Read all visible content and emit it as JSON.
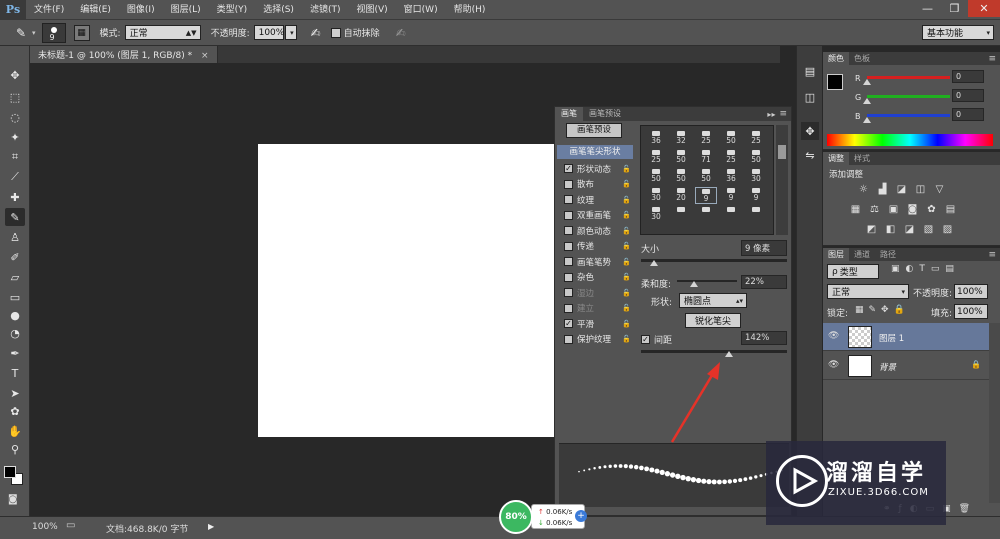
{
  "app": {
    "logo": "Ps"
  },
  "menu": [
    "文件(F)",
    "编辑(E)",
    "图像(I)",
    "图层(L)",
    "类型(Y)",
    "选择(S)",
    "滤镜(T)",
    "视图(V)",
    "窗口(W)",
    "帮助(H)"
  ],
  "window_buttons": {
    "minimize": "—",
    "restore": "❐",
    "close": "✕"
  },
  "options": {
    "brush_size": "9",
    "mode_label": "模式:",
    "mode_value": "正常",
    "opacity_label": "不透明度:",
    "opacity_value": "100%",
    "auto_erase_label": "自动抹除",
    "workspace": "基本功能"
  },
  "document": {
    "tab_title": "未标题-1 @ 100% (图层 1, RGB/8) *"
  },
  "statusbar": {
    "zoom": "100%",
    "doc_info": "文档:468.8K/0 字节"
  },
  "brush_panel": {
    "tabs": [
      "画笔",
      "画笔预设"
    ],
    "preset_button": "画笔预设",
    "tip_shape": "画笔笔尖形状",
    "options": [
      {
        "label": "形状动态",
        "checked": true,
        "dim": false
      },
      {
        "label": "散布",
        "checked": false,
        "dim": false
      },
      {
        "label": "纹理",
        "checked": false,
        "dim": false
      },
      {
        "label": "双重画笔",
        "checked": false,
        "dim": false
      },
      {
        "label": "颜色动态",
        "checked": false,
        "dim": false
      },
      {
        "label": "传递",
        "checked": false,
        "dim": false
      },
      {
        "label": "画笔笔势",
        "checked": false,
        "dim": false
      },
      {
        "label": "杂色",
        "checked": false,
        "dim": false
      },
      {
        "label": "湿边",
        "checked": false,
        "dim": true
      },
      {
        "label": "建立",
        "checked": false,
        "dim": true
      },
      {
        "label": "平滑",
        "checked": true,
        "dim": false
      },
      {
        "label": "保护纹理",
        "checked": false,
        "dim": false
      }
    ],
    "brush_sizes": [
      "36",
      "32",
      "25",
      "50",
      "25",
      "25",
      "50",
      "71",
      "25",
      "50",
      "50",
      "50",
      "50",
      "36",
      "30",
      "30",
      "20",
      "9",
      "9",
      "9",
      "30"
    ],
    "selected_brush_index": 17,
    "size_label": "大小",
    "size_value": "9 像素",
    "hardness_label": "柔和度:",
    "hardness_value": "22%",
    "shape_label": "形状:",
    "shape_value": "椭圆点",
    "sharpen_button": "锐化笔尖",
    "spacing_label": "间距",
    "spacing_checked": true,
    "spacing_value": "142%"
  },
  "color_panel": {
    "tabs": [
      "颜色",
      "色板"
    ],
    "channels": [
      {
        "label": "R",
        "value": "0",
        "color": "#d62020"
      },
      {
        "label": "G",
        "value": "0",
        "color": "#20b020"
      },
      {
        "label": "B",
        "value": "0",
        "color": "#2040d0"
      }
    ]
  },
  "adjust_panel": {
    "tabs": [
      "调整",
      "样式"
    ],
    "title": "添加调整"
  },
  "layers_panel": {
    "tabs": [
      "图层",
      "通道",
      "路径"
    ],
    "filter": "类型",
    "blend_mode": "正常",
    "opacity_label": "不透明度:",
    "opacity_value": "100%",
    "lock_label": "锁定:",
    "fill_label": "填充:",
    "fill_value": "100%",
    "layers": [
      {
        "name": "图层 1",
        "selected": true
      },
      {
        "name": "背景",
        "selected": false
      }
    ]
  },
  "net_widget": {
    "percent": "80%",
    "up": "0.06K/s",
    "down": "0.06K/s"
  },
  "watermark": {
    "title": "溜溜自学",
    "url": "ZIXUE.3D66.COM"
  }
}
